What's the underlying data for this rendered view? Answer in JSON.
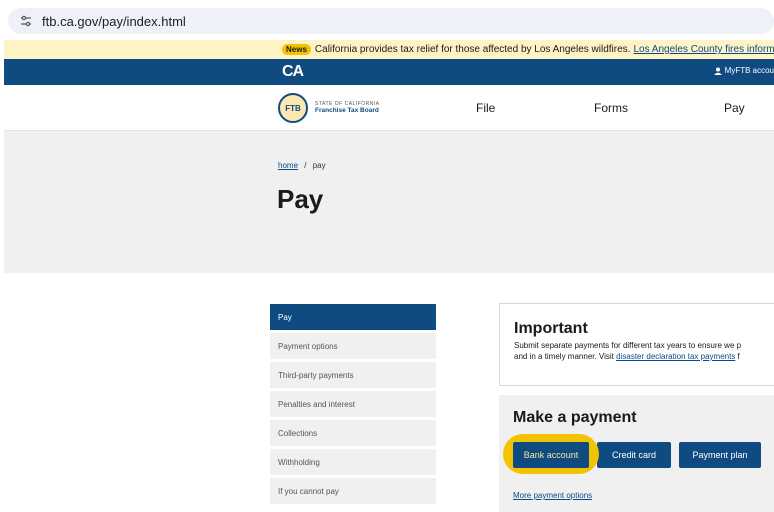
{
  "browser": {
    "url": "ftb.ca.gov/pay/index.html",
    "url_icon": "tune-icon"
  },
  "news": {
    "badge": "News",
    "text": "California provides tax relief for those affected by Los Angeles wildfires.",
    "link": "Los Angeles County fires information"
  },
  "topnav": {
    "logo": "CA",
    "account_label": "MyFTB accou"
  },
  "logo": {
    "seal": "FTB",
    "line1": "STATE OF CALIFORNIA",
    "line2": "Franchise Tax Board"
  },
  "mainnav": {
    "items": [
      {
        "label": "File"
      },
      {
        "label": "Forms"
      },
      {
        "label": "Pay"
      }
    ]
  },
  "breadcrumb": {
    "home": "home",
    "separator": "/",
    "current": "pay"
  },
  "page_title": "Pay",
  "sidebar": {
    "items": [
      {
        "label": "Pay",
        "active": true
      },
      {
        "label": "Payment options"
      },
      {
        "label": "Third-party payments"
      },
      {
        "label": "Penalties and interest"
      },
      {
        "label": "Collections"
      },
      {
        "label": "Withholding"
      },
      {
        "label": "If you cannot pay"
      }
    ]
  },
  "important": {
    "title": "Important",
    "line1": "Submit separate payments for different tax years to ensure we p",
    "line2_prefix": "and in a timely manner. Visit",
    "line2_link": "disaster declaration tax payments",
    "line2_suffix": "f"
  },
  "payment": {
    "title": "Make a payment",
    "buttons": {
      "bank": "Bank account",
      "card": "Credit card",
      "plan": "Payment plan"
    },
    "more_link": "More payment options"
  },
  "colors": {
    "brand_blue": "#0f4b81",
    "highlight": "#f2c300",
    "news_bg": "#fdf3c4",
    "panel_bg": "#f0f0f0"
  }
}
